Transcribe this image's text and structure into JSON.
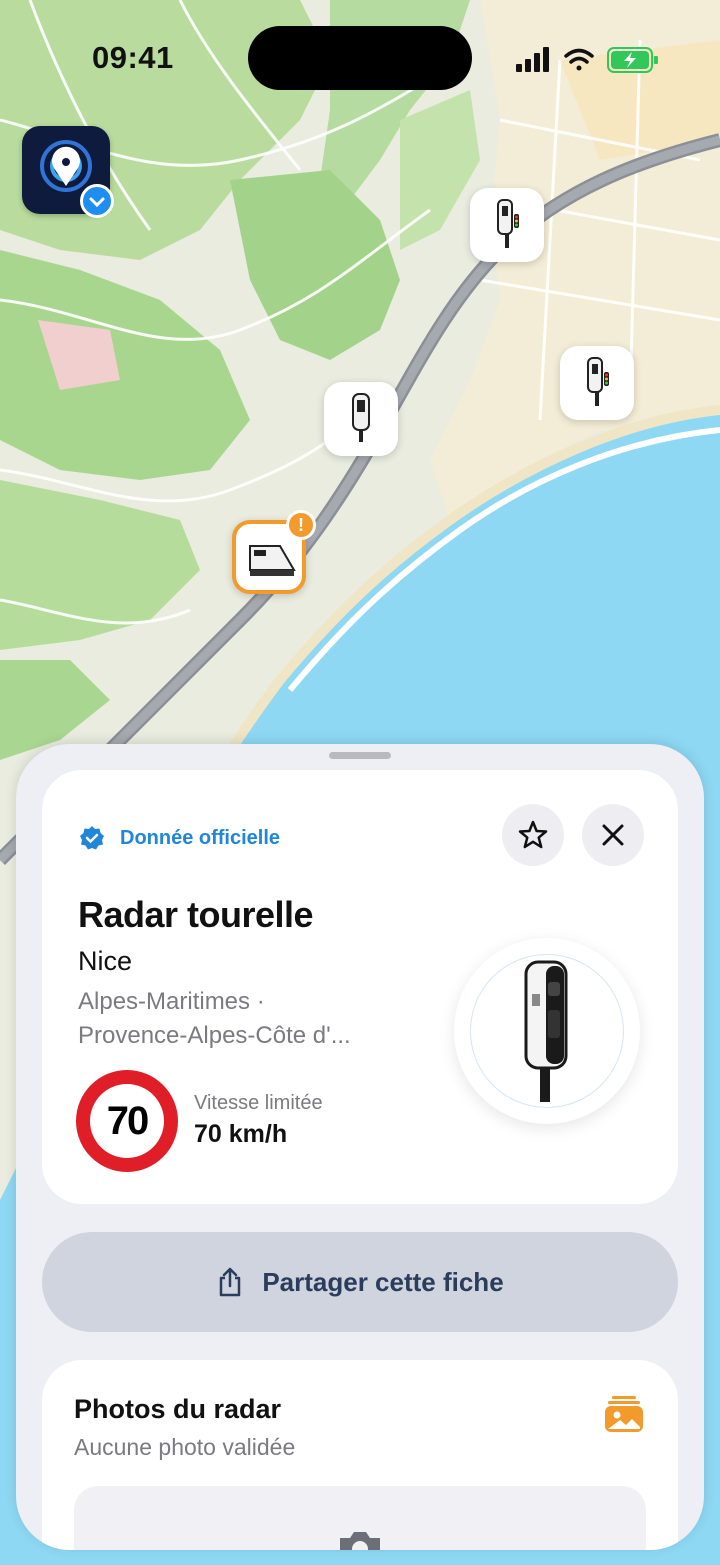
{
  "status_bar": {
    "time": "09:41"
  },
  "sheet": {
    "official_label": "Donnée officielle",
    "radar_type": "Radar tourelle",
    "city": "Nice",
    "region_line1": "Alpes-Maritimes ·",
    "region_line2": "Provence-Alpes-Côte d'...",
    "speed_sign_value": "70",
    "speed_label": "Vitesse limitée",
    "speed_value": "70 km/h",
    "share_label": "Partager cette fiche",
    "photos_title": "Photos du radar",
    "photos_subtitle": "Aucune photo validée"
  },
  "colors": {
    "accent": "#1f86dc",
    "warning": "#f39a2c",
    "speed_sign_red": "#e01e27",
    "sea": "#8ed8f4"
  },
  "icons": [
    "verified-badge-icon",
    "star-icon",
    "close-icon",
    "share-icon",
    "photo-stack-icon",
    "camera-icon",
    "cellular-icon",
    "wifi-icon",
    "battery-charging-icon"
  ]
}
